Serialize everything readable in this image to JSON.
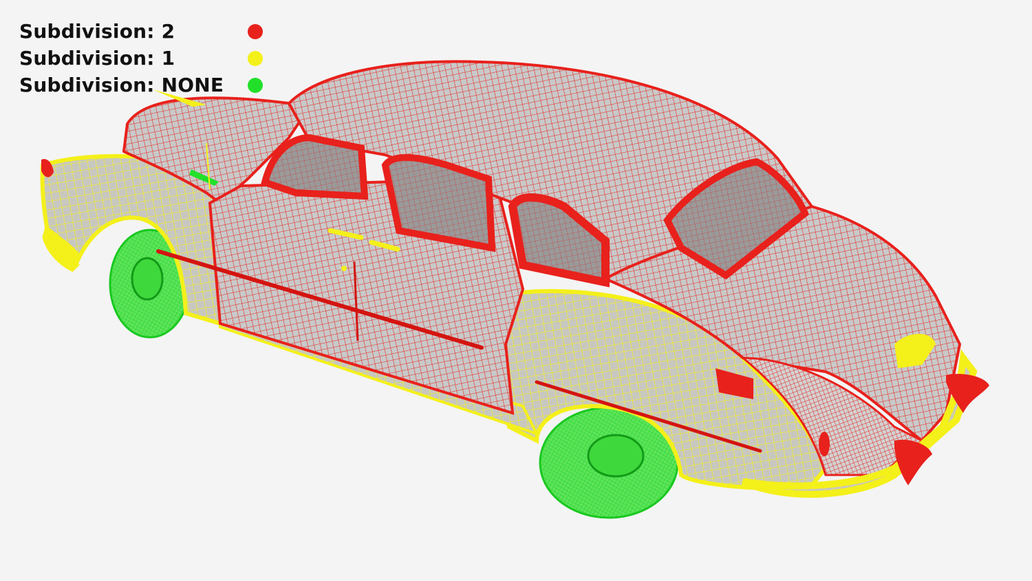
{
  "legend": [
    {
      "label": "Subdivision: 2",
      "color": "#e8211c"
    },
    {
      "label": "Subdivision: 1",
      "color": "#f4f01a"
    },
    {
      "label": "Subdivision: NONE",
      "color": "#22e02a"
    }
  ],
  "colors": {
    "background": "#f4f4f4",
    "mesh_base": "#c6c6c6"
  }
}
